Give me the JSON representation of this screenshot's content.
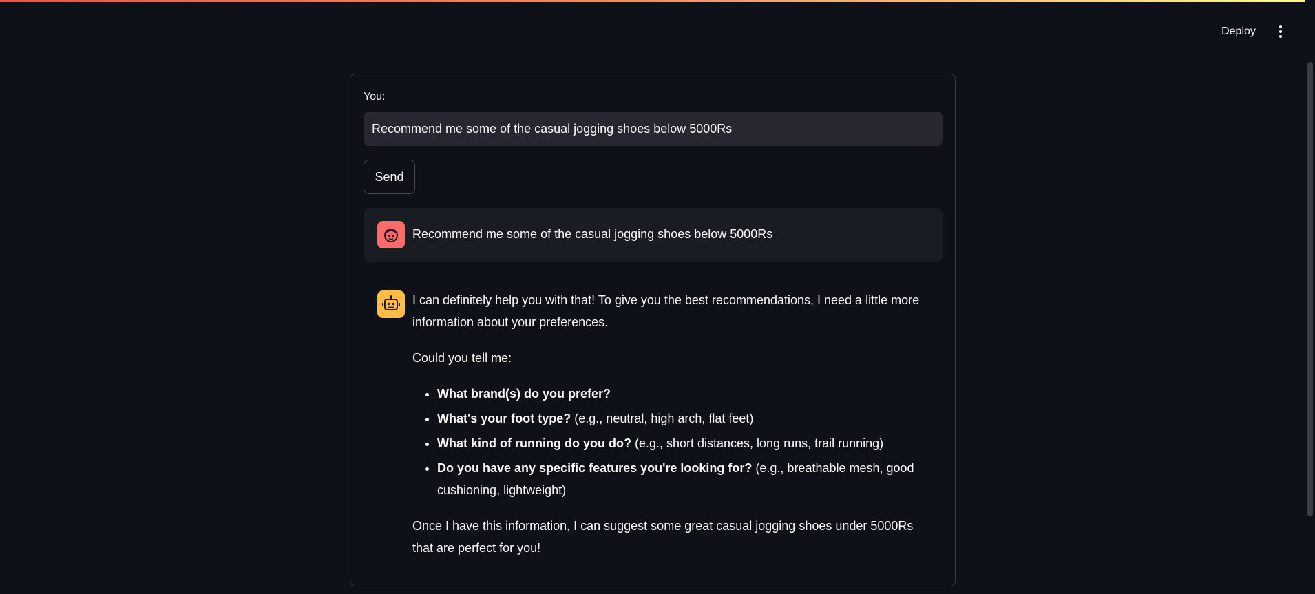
{
  "header": {
    "deploy_label": "Deploy",
    "menu_icon": "more-vert-icon"
  },
  "form": {
    "input_label": "You:",
    "input_value": "Recommend me some of the casual jogging shoes below 5000Rs",
    "send_label": "Send"
  },
  "messages": {
    "user": {
      "avatar_icon": "user-face-icon",
      "avatar_color": "#ff6b6b",
      "text": "Recommend me some of the casual jogging shoes below 5000Rs"
    },
    "assistant": {
      "avatar_icon": "robot-icon",
      "avatar_color": "#ffbd45",
      "intro": "I can definitely help you with that! To give you the best recommendations, I need a little more information about your preferences.",
      "ask": "Could you tell me:",
      "questions": [
        {
          "bold": "What brand(s) do you prefer?",
          "rest": ""
        },
        {
          "bold": "What's your foot type?",
          "rest": " (e.g., neutral, high arch, flat feet)"
        },
        {
          "bold": "What kind of running do you do?",
          "rest": " (e.g., short distances, long runs, trail running)"
        },
        {
          "bold": "Do you have any specific features you're looking for?",
          "rest": " (e.g., breathable mesh, good cushioning, lightweight)"
        }
      ],
      "closing": "Once I have this information, I can suggest some great casual jogging shoes under 5000Rs that are perfect for you!"
    }
  },
  "colors": {
    "background": "#0e1117",
    "input_bg": "#262730",
    "user_msg_bg": "#1a1c24",
    "accent_gradient_start": "#ff4b4b",
    "accent_gradient_end": "#fffd80"
  }
}
